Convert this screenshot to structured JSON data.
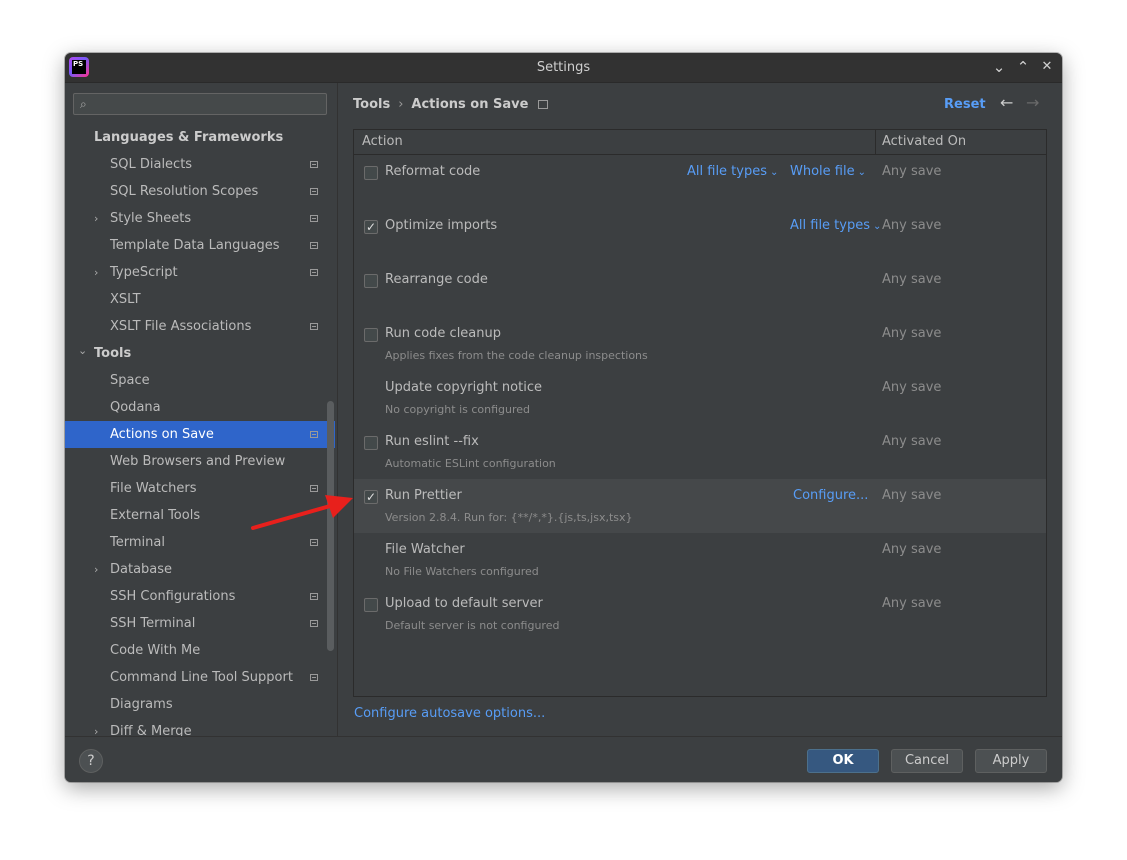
{
  "window": {
    "title": "Settings",
    "app_icon_text": "PS",
    "controls": {
      "minimize": "⌄",
      "maximize": "⌃",
      "close": "✕"
    }
  },
  "sidebar": {
    "search_placeholder": "",
    "items": [
      {
        "label": "Languages & Frameworks",
        "level": 0,
        "group": true
      },
      {
        "label": "SQL Dialects",
        "level": 1,
        "project": true
      },
      {
        "label": "SQL Resolution Scopes",
        "level": 1,
        "project": true
      },
      {
        "label": "Style Sheets",
        "level": 1,
        "expandable": true,
        "project": true
      },
      {
        "label": "Template Data Languages",
        "level": 1,
        "project": true
      },
      {
        "label": "TypeScript",
        "level": 1,
        "expandable": true,
        "project": true
      },
      {
        "label": "XSLT",
        "level": 1
      },
      {
        "label": "XSLT File Associations",
        "level": 1,
        "project": true
      },
      {
        "label": "Tools",
        "level": 0,
        "group": true,
        "expanded": true
      },
      {
        "label": "Space",
        "level": 1
      },
      {
        "label": "Qodana",
        "level": 1
      },
      {
        "label": "Actions on Save",
        "level": 1,
        "project": true,
        "selected": true
      },
      {
        "label": "Web Browsers and Preview",
        "level": 1
      },
      {
        "label": "File Watchers",
        "level": 1,
        "project": true
      },
      {
        "label": "External Tools",
        "level": 1
      },
      {
        "label": "Terminal",
        "level": 1,
        "project": true
      },
      {
        "label": "Database",
        "level": 1,
        "expandable": true
      },
      {
        "label": "SSH Configurations",
        "level": 1,
        "project": true
      },
      {
        "label": "SSH Terminal",
        "level": 1,
        "project": true
      },
      {
        "label": "Code With Me",
        "level": 1
      },
      {
        "label": "Command Line Tool Support",
        "level": 1,
        "project": true
      },
      {
        "label": "Diagrams",
        "level": 1
      },
      {
        "label": "Diff & Merge",
        "level": 1,
        "expandable": true
      }
    ]
  },
  "content": {
    "breadcrumb": {
      "parent": "Tools",
      "separator": "›",
      "current": "Actions on Save"
    },
    "reset_label": "Reset",
    "nav_back": "←",
    "nav_forward": "→",
    "table": {
      "headers": {
        "action": "Action",
        "activated_on": "Activated On"
      },
      "rows": [
        {
          "title": "Reformat code",
          "subtitle": "",
          "checkbox": true,
          "checked": false,
          "links": [
            "All file types",
            "Whole file"
          ],
          "activated": "Any save"
        },
        {
          "title": "Optimize imports",
          "subtitle": "",
          "checkbox": true,
          "checked": true,
          "links": [
            "All file types"
          ],
          "activated": "Any save"
        },
        {
          "title": "Rearrange code",
          "subtitle": "",
          "checkbox": true,
          "checked": false,
          "links": [],
          "activated": "Any save"
        },
        {
          "title": "Run code cleanup",
          "subtitle": "Applies fixes from the code cleanup inspections",
          "checkbox": true,
          "checked": false,
          "links": [],
          "activated": "Any save"
        },
        {
          "title": "Update copyright notice",
          "subtitle": "No copyright is configured",
          "checkbox": false,
          "checked": false,
          "links": [],
          "activated": "Any save"
        },
        {
          "title": "Run eslint --fix",
          "subtitle": "Automatic ESLint configuration",
          "checkbox": true,
          "checked": false,
          "links": [],
          "activated": "Any save"
        },
        {
          "title": "Run Prettier",
          "subtitle": "Version 2.8.4. Run for: {**/*,*}.{js,ts,jsx,tsx}",
          "checkbox": true,
          "checked": true,
          "configure": "Configure...",
          "highlight": true,
          "links": [],
          "activated": "Any save"
        },
        {
          "title": "File Watcher",
          "subtitle": "No File Watchers configured",
          "checkbox": false,
          "checked": false,
          "links": [],
          "activated": "Any save"
        },
        {
          "title": "Upload to default server",
          "subtitle": "Default server is not configured",
          "checkbox": true,
          "checked": false,
          "links": [],
          "activated": "Any save"
        }
      ]
    },
    "autosave_link": "Configure autosave options..."
  },
  "footer": {
    "help": "?",
    "ok": "OK",
    "cancel": "Cancel",
    "apply": "Apply"
  },
  "colors": {
    "background": "#3c3f41",
    "selection": "#2f65ca",
    "link": "#589df6",
    "annotation_arrow": "#e8201c"
  }
}
